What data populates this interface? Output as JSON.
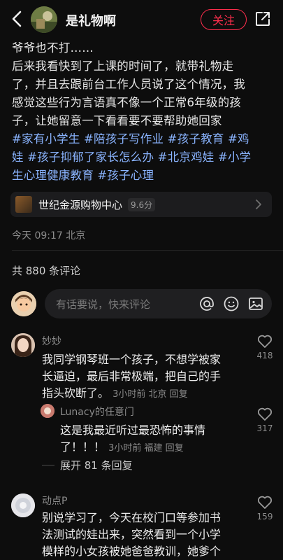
{
  "header": {
    "author_name": "是礼物啊",
    "follow_label": "关注",
    "icons": [
      "back-icon",
      "share-icon"
    ],
    "accent": "#ff2e4d"
  },
  "post": {
    "lines": [
      "爷爷也不打……",
      "后来我看快到了上课的时间了，就带礼物走",
      "了，并且去跟前台工作人员说了这个情况，我",
      "感觉这些行为言语真不像一个正常6年级的孩",
      "子，让她留意一下看看要不要帮助她回家"
    ],
    "tag_lines": [
      [
        "#家有小学生",
        "#陪孩子写作业",
        "#孩子教育",
        "#鸡"
      ],
      [
        "娃",
        "#孩子抑郁了家长怎么办",
        "#北京鸡娃",
        "#小学"
      ],
      [
        "生心理健康教育",
        "#孩子心理"
      ]
    ],
    "tag_color": "#8ab4ff",
    "location": {
      "name": "世纪金源购物中心",
      "rating": "9.6分"
    },
    "time": "今天 09:17 北京"
  },
  "comments_section": {
    "count_label": "共 880 条评论",
    "input_placeholder": "有话要说，快来评论",
    "input_icons": [
      "at-icon",
      "emoji-icon",
      "image-icon"
    ],
    "comments": [
      {
        "user": "妙妙",
        "lines": [
          "我同学钢琴班一个孩子，不想学被家",
          "长逼迫，最后非常极端，把自己的手",
          "指头砍断了。"
        ],
        "meta": "3小时前 北京 回复",
        "likes": "418"
      },
      {
        "user": "动点P",
        "lines": [
          "别说学习了，今天在校门口等参加书",
          "法测试的娃出来，突然看到一个小学",
          "模样的小女孩被她爸爸教训，她爹个"
        ],
        "likes": "159"
      }
    ],
    "reply": {
      "user": "Lunacy的任意门",
      "lines": [
        "这是我最近听过最恐怖的事情",
        "了！！！"
      ],
      "meta": "3小时前 福建 回复",
      "likes": "317"
    },
    "expand_label": "展开 81 条回复"
  }
}
